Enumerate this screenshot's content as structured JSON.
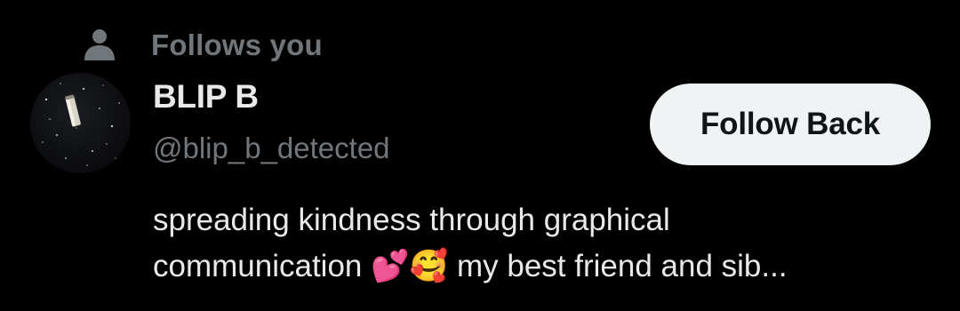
{
  "follows_indicator": {
    "icon": "person-icon",
    "label": "Follows you"
  },
  "user": {
    "display_name": "BLIP B",
    "handle": "@blip_b_detected",
    "avatar_icon": "space-capsule-avatar",
    "follow_button_label": "Follow Back",
    "bio_line_1": "spreading kindness through graphical",
    "bio_line_2": "communication 💕🥰 my best friend and sib..."
  },
  "colors": {
    "background": "#000000",
    "primary_text": "#e7e9ea",
    "secondary_text": "#71767b",
    "button_bg": "#eff3f4",
    "button_text": "#0f1419"
  }
}
